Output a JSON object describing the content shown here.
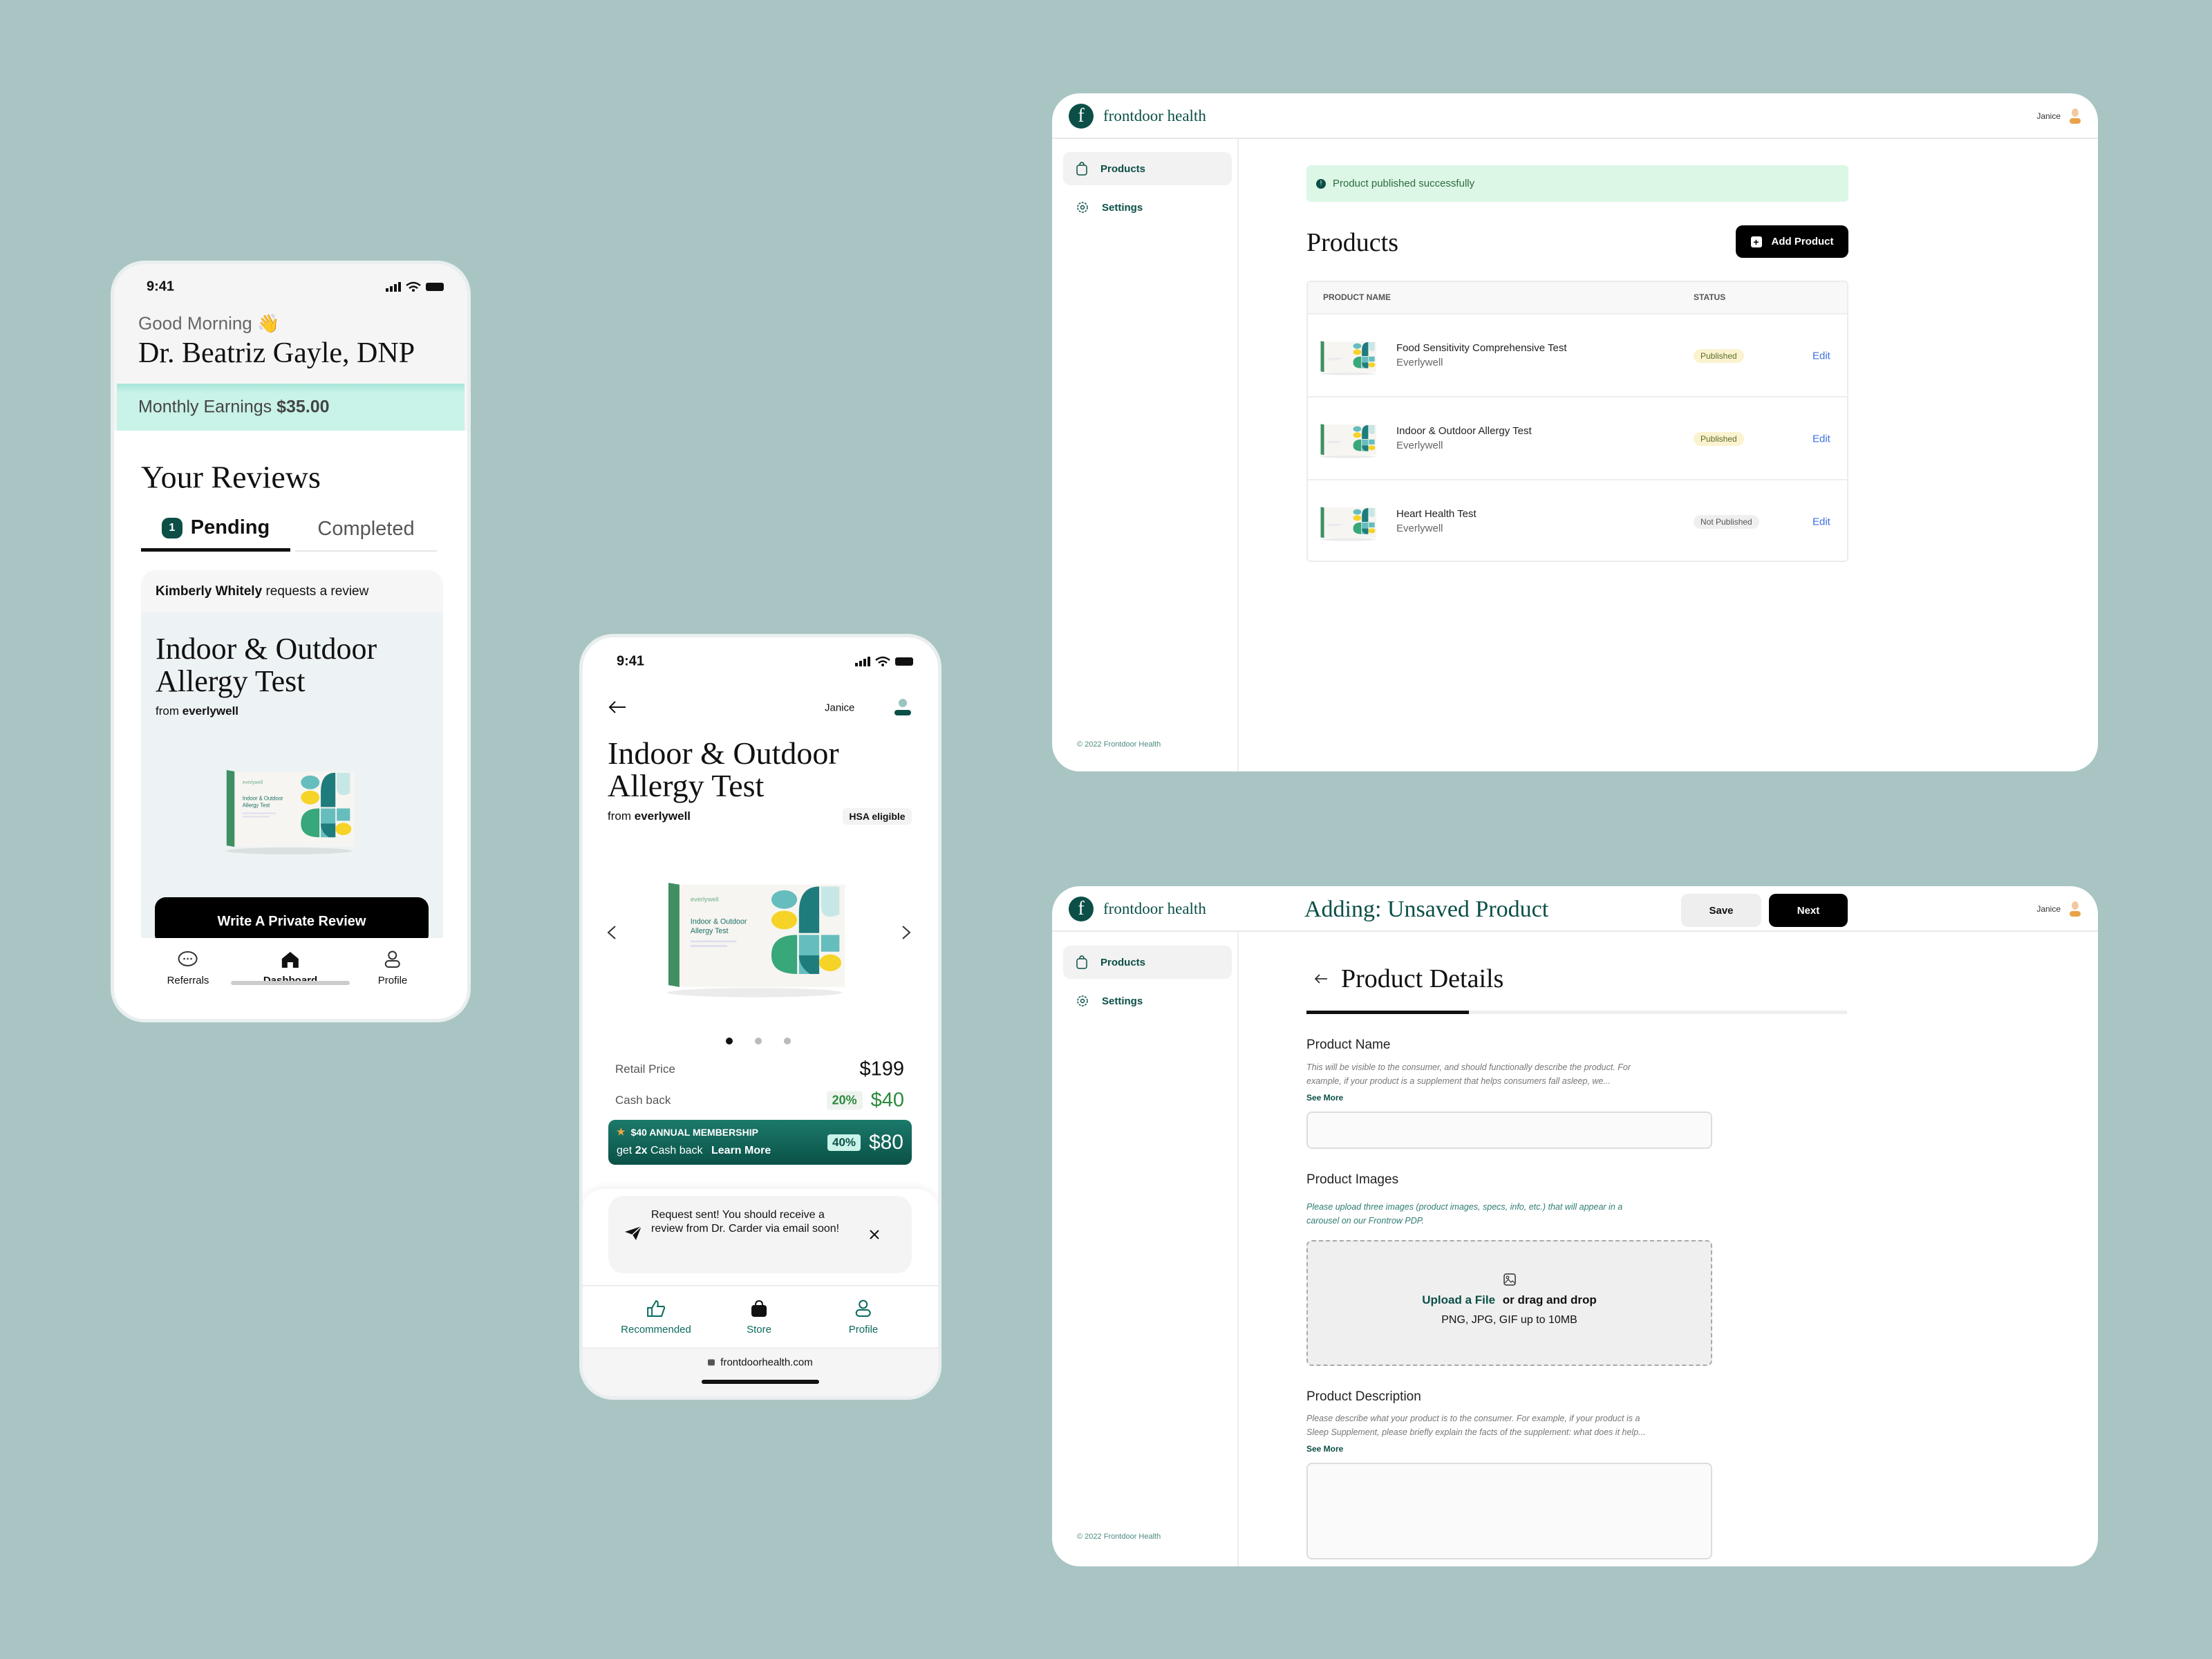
{
  "colors": {
    "background": "#a9c5c3",
    "brand": "#0b4f47",
    "earnings_band": "#c9f2e8",
    "alert_bg": "#dcf7e6",
    "published_bg": "#fbf3cf",
    "edit_link": "#3b6fe0",
    "cashback_green": "#2d8a3e"
  },
  "product_box": {
    "brand": "everlywell",
    "title_line1": "Indoor & Outdoor",
    "title_line2": "Allergy Test"
  },
  "phone_dashboard": {
    "status_time": "9:41",
    "greeting": "Good Morning 👋",
    "name": "Dr. Beatriz Gayle, DNP",
    "earnings_label": "Monthly Earnings",
    "earnings_value": "$35.00",
    "section_title": "Your Reviews",
    "tabs": [
      {
        "label": "Pending",
        "count": "1",
        "active": true
      },
      {
        "label": "Completed",
        "active": false
      }
    ],
    "card": {
      "requester": "Kimberly Whitely",
      "request_text": "requests a review",
      "title_line1": "Indoor & Outdoor",
      "title_line2": "Allergy Test",
      "from_label": "from",
      "brand": "everlywell",
      "button": "Write A Private Review"
    },
    "nav": [
      {
        "label": "Referrals",
        "icon": "chat-bubble-icon"
      },
      {
        "label": "Dashboard",
        "icon": "home-icon",
        "active": true
      },
      {
        "label": "Profile",
        "icon": "user-icon"
      }
    ]
  },
  "phone_product": {
    "status_time": "9:41",
    "user": "Janice",
    "title_line1": "Indoor & Outdoor",
    "title_line2": "Allergy Test",
    "from_label": "from",
    "brand": "everlywell",
    "hsa_badge": "HSA eligible",
    "carousel": {
      "current": 1,
      "total": 3
    },
    "retail_label": "Retail Price",
    "retail_value": "$199",
    "cashback_label": "Cash back",
    "cashback_pct": "20%",
    "cashback_value": "$40",
    "membership": {
      "title": "$40 ANNUAL MEMBERSHIP",
      "line_prefix": "get",
      "line_bold": "2x",
      "line_suffix": "Cash back",
      "link": "Learn More",
      "pct": "40%",
      "value": "$80"
    },
    "toast": "Request sent! You should receive a review from Dr. Carder via email soon!",
    "nav": [
      {
        "label": "Recommended",
        "icon": "thumbs-up-icon"
      },
      {
        "label": "Store",
        "icon": "shopping-bag-icon"
      },
      {
        "label": "Profile",
        "icon": "user-icon"
      }
    ],
    "url": "frontdoorhealth.com"
  },
  "desktop_products": {
    "brand": "frontdoor health",
    "user": "Janice",
    "sidebar": [
      {
        "label": "Products",
        "icon": "bag-icon",
        "active": true
      },
      {
        "label": "Settings",
        "icon": "gear-icon"
      }
    ],
    "footer": "© 2022 Frontdoor Health",
    "alert": "Product published successfully",
    "title": "Products",
    "add_button": "Add Product",
    "columns": [
      "PRODUCT NAME",
      "STATUS"
    ],
    "rows": [
      {
        "name": "Food Sensitivity Comprehensive Test",
        "vendor": "Everlywell",
        "status": "Published",
        "action": "Edit"
      },
      {
        "name": "Indoor & Outdoor Allergy Test",
        "vendor": "Everlywell",
        "status": "Published",
        "action": "Edit"
      },
      {
        "name": "Heart Health Test",
        "vendor": "Everlywell",
        "status": "Not Published",
        "action": "Edit"
      }
    ]
  },
  "desktop_add": {
    "brand": "frontdoor health",
    "page_title": "Adding: Unsaved Product",
    "save": "Save",
    "next": "Next",
    "user": "Janice",
    "sidebar": [
      {
        "label": "Products",
        "icon": "bag-icon",
        "active": true
      },
      {
        "label": "Settings",
        "icon": "gear-icon"
      }
    ],
    "footer": "© 2022 Frontdoor Health",
    "section_title": "Product Details",
    "progress_pct": 30,
    "name_label": "Product Name",
    "name_help_1": "This will be visible to the consumer, and should functionally describe the product. For",
    "name_help_2": "example, if your product is a supplement that helps consumers fall asleep, we...",
    "see_more": "See More",
    "name_value": "",
    "images_label": "Product Images",
    "images_help_1": "Please upload three images (product images, specs, info, etc.) that will appear in a",
    "images_help_2": "carousel on our Frontrow PDP.",
    "upload_link": "Upload a File",
    "upload_rest": "or drag and drop",
    "upload_formats": "PNG, JPG, GIF up to 10MB",
    "desc_label": "Product Description",
    "desc_help_1": "Please describe what your product is to the consumer. For example, if your product is a",
    "desc_help_2": "Sleep Supplement, please briefly explain the facts of the supplement: what does it help...",
    "desc_value": ""
  }
}
